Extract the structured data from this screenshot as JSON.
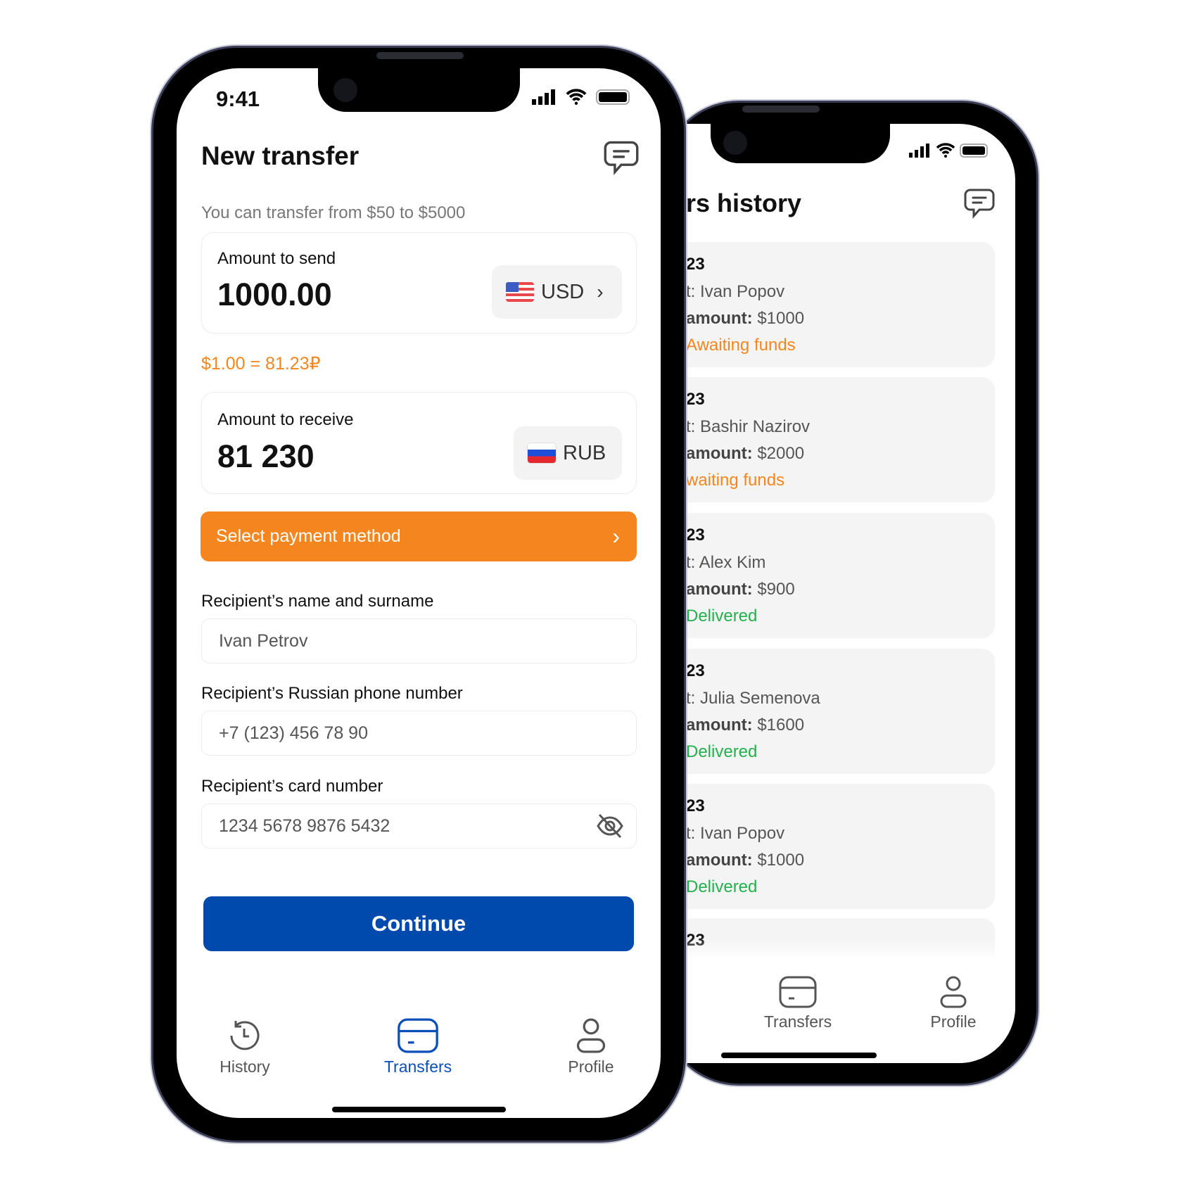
{
  "front": {
    "status_time": "9:41",
    "title": "New transfer",
    "subtitle": "You can transfer from $50 to $5000",
    "send": {
      "label": "Amount to send",
      "value": "1000.00",
      "currency": "USD"
    },
    "rate": "$1.00 = 81.23₽",
    "receive": {
      "label": "Amount to receive",
      "value": "81 230",
      "currency": "RUB"
    },
    "payment_button": "Select payment method",
    "fields": [
      {
        "label": "Recipient’s name and surname",
        "value": "Ivan Petrov"
      },
      {
        "label": "Recipient’s Russian phone number",
        "value": "+7 (123) 456 78 90"
      },
      {
        "label": "Recipient’s card number",
        "value": "1234 5678 9876 5432"
      }
    ],
    "continue": "Continue",
    "nav": [
      {
        "label": "History",
        "icon": "history-icon"
      },
      {
        "label": "Transfers",
        "icon": "card-icon",
        "active": true
      },
      {
        "label": "Profile",
        "icon": "user-icon"
      }
    ]
  },
  "back": {
    "title": "rs history",
    "cards": [
      {
        "date": "23",
        "recipient": "t: Ivan Popov",
        "amount_label": "amount:",
        "amount": "$1000",
        "status": "Awaiting funds",
        "state": "awaiting"
      },
      {
        "date": "23",
        "recipient": "t: Bashir Nazirov",
        "amount_label": "amount:",
        "amount": "$2000",
        "status": "waiting funds",
        "state": "awaiting"
      },
      {
        "date": "23",
        "recipient": "t: Alex Kim",
        "amount_label": "amount:",
        "amount": "$900",
        "status": "Delivered",
        "state": "delivered"
      },
      {
        "date": "23",
        "recipient": "t: Julia Semenova",
        "amount_label": "amount:",
        "amount": "$1600",
        "status": "Delivered",
        "state": "delivered"
      },
      {
        "date": "23",
        "recipient": "t: Ivan Popov",
        "amount_label": "amount:",
        "amount": "$1000",
        "status": "Delivered",
        "state": "delivered"
      },
      {
        "date": "23"
      }
    ],
    "nav": [
      {
        "label": "Transfers"
      },
      {
        "label": "Profile"
      }
    ]
  },
  "colors": {
    "accent": "#F5861F",
    "primary": "#004AAD",
    "delivered": "#22B14C",
    "awaiting": "#F5861F"
  }
}
